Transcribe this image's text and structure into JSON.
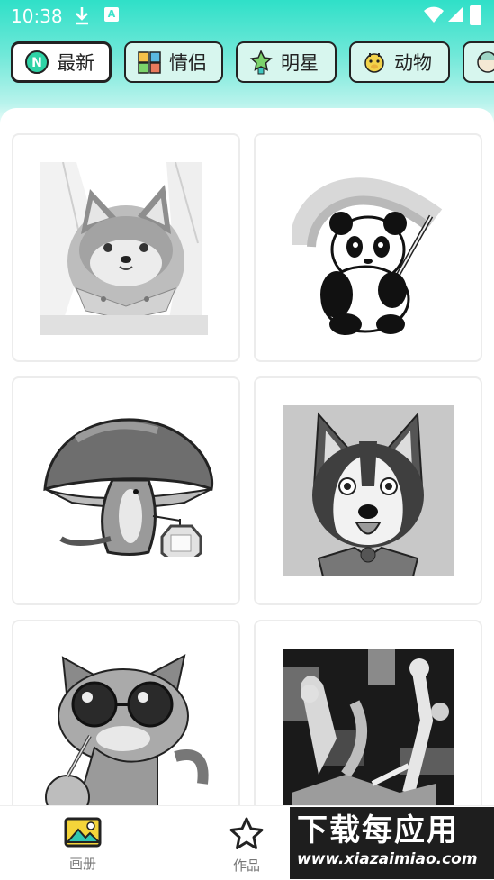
{
  "status_bar": {
    "time": "10:38",
    "notif_label": "A"
  },
  "tabs": [
    {
      "label": "最新",
      "icon": "new-badge-icon",
      "active": true
    },
    {
      "label": "情侣",
      "icon": "couple-icon",
      "active": false
    },
    {
      "label": "明星",
      "icon": "star-figure-icon",
      "active": false
    },
    {
      "label": "动物",
      "icon": "giraffe-icon",
      "active": false
    }
  ],
  "gallery": [
    {
      "name": "shiba-dog"
    },
    {
      "name": "panda-rainbow"
    },
    {
      "name": "mushroom-otter-lantern"
    },
    {
      "name": "husky-dog"
    },
    {
      "name": "cat-sunglasses-coconut"
    },
    {
      "name": "abstract-dancers"
    }
  ],
  "bottom_nav": {
    "album": "画册",
    "works": "作品"
  },
  "watermark": {
    "title": "下载每应用",
    "url": "www.xiazaimiao.com"
  }
}
